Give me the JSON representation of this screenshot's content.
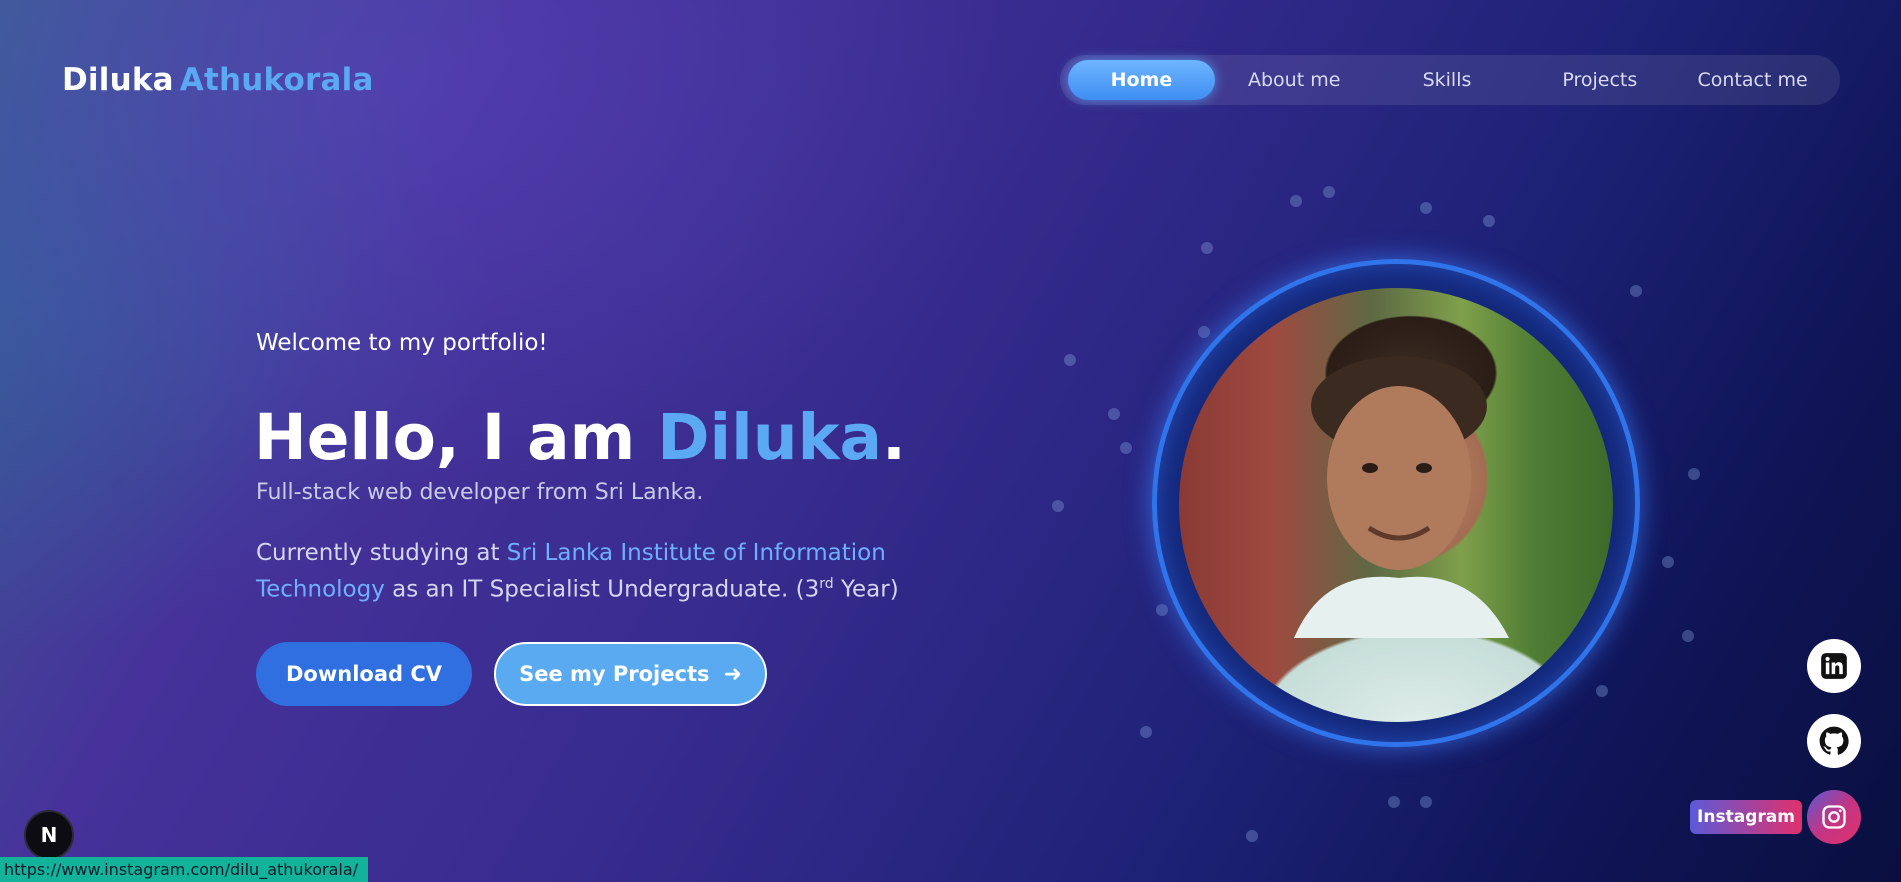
{
  "header": {
    "logo_first": "Diluka",
    "logo_last": "Athukorala"
  },
  "nav": {
    "items": [
      {
        "label": "Home",
        "active": true
      },
      {
        "label": "About me",
        "active": false
      },
      {
        "label": "Skills",
        "active": false
      },
      {
        "label": "Projects",
        "active": false
      },
      {
        "label": "Contact me",
        "active": false
      }
    ]
  },
  "hero": {
    "welcome": "Welcome to my portfolio!",
    "hello_prefix": "Hello, I am ",
    "hello_name": "Diluka",
    "hello_suffix": ".",
    "role": "Full-stack web developer from Sri Lanka.",
    "study_prefix": "Currently studying at ",
    "study_institution": "Sri Lanka Institute of Information Technology",
    "study_middle": " as an IT Specialist Undergraduate. (3",
    "study_sup": "rd",
    "study_suffix": " Year)",
    "download_cv_label": "Download CV",
    "see_projects_label": "See my Projects",
    "see_projects_arrow": "➜"
  },
  "social": {
    "instagram_label": "Instagram",
    "icons": [
      "linkedin-icon",
      "github-icon",
      "instagram-icon"
    ]
  },
  "overlay": {
    "next_badge": "N",
    "status_url": "https://www.instagram.com/dilu_athukorala/"
  },
  "colors": {
    "accent": "#5aa9f2",
    "button_primary": "#2f6fe0",
    "ring": "#2f74ea"
  }
}
